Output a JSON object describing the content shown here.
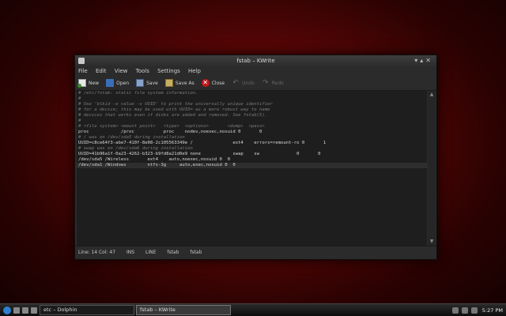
{
  "window": {
    "title": "fstab – KWrite"
  },
  "menu": [
    "File",
    "Edit",
    "View",
    "Tools",
    "Settings",
    "Help"
  ],
  "toolbar": {
    "new": "New",
    "open": "Open",
    "save": "Save",
    "saveas": "Save As",
    "close": "Close",
    "undo": "Undo",
    "redo": "Redo"
  },
  "editor": {
    "lines": [
      "# /etc/fstab: static file system information.",
      "#",
      "# Use 'blkid -o value -s UUID' to print the universally unique identifier",
      "# for a device; this may be used with UUID= as a more robust way to name",
      "# devices that works even if disks are added and removed. See fstab(5).",
      "#",
      "# <file system> <mount point>   <type>  <options>       <dump>  <pass>",
      "proc            /proc           proc    nodev,noexec,nosuid 0       0",
      "# / was on /dev/sda5 during installation",
      "UUID=c8ce64f3-abe7-410f-8e08-2c105563349e /               ext4    errors=remount-ro 0       1",
      "# swap was on /dev/sda6 during installation",
      "UUID=41b96a1f-0a23-4262-b323-b9fd8a21d0e9 none            swap    sw              0       0",
      "/dev/sda5 /Wireless       ext4    auto,noexec,nosuid 0  0",
      "/dev/sda1 /Windows        ntfs-3g     auto,exec,nosuid 0  0"
    ]
  },
  "status": {
    "position": "Line: 14 Col: 47",
    "mode": "INS",
    "eol": "LINE",
    "file1": "fstab",
    "file2": "fstab"
  },
  "taskbar": {
    "tasks": [
      "etc – Dolphin",
      "fstab – KWrite"
    ],
    "clock": "5:27 PM"
  }
}
